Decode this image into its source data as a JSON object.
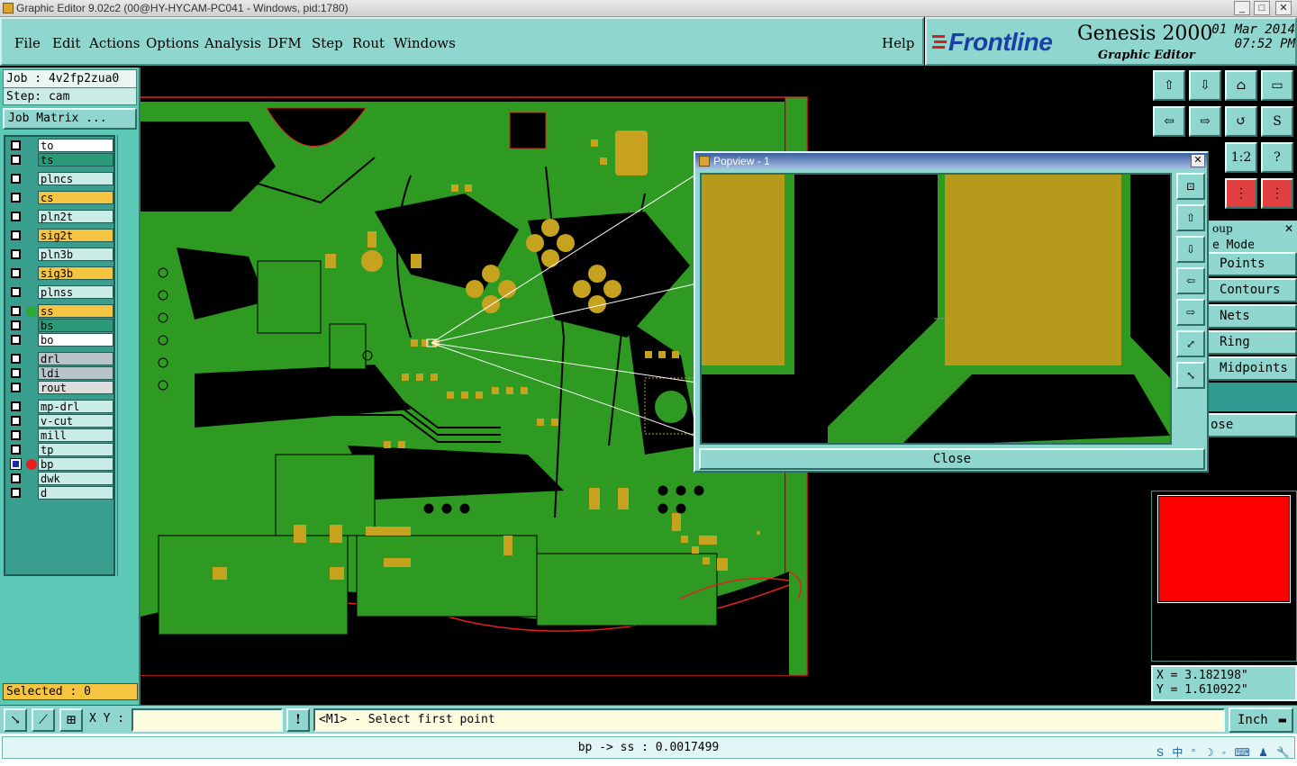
{
  "window": {
    "title": "Graphic Editor 9.02c2 (00@HY-HYCAM-PC041 - Windows, pid:1780)"
  },
  "menu": [
    "File",
    "Edit",
    "Actions",
    "Options",
    "Analysis",
    "DFM",
    "Step",
    "Rout",
    "Windows"
  ],
  "help_label": "Help",
  "logo": {
    "brand": "Frontline",
    "product": "Genesis 2000",
    "subtitle": "Graphic Editor",
    "date": "01 Mar 2014",
    "time": "07:52 PM"
  },
  "job": {
    "job_label": "Job : 4v2fp2zua0",
    "step_label": "Step: cam",
    "matrix_button": "Job Matrix ..."
  },
  "layers": [
    {
      "name": "to",
      "color": "#ffffff",
      "checked": false
    },
    {
      "name": "ts",
      "color": "#2a9a78",
      "checked": false
    },
    {
      "name": "plncs",
      "color": "#c9ece6",
      "checked": false
    },
    {
      "name": "cs",
      "color": "#f5c542",
      "checked": false
    },
    {
      "name": "pln2t",
      "color": "#c9ece6",
      "checked": false
    },
    {
      "name": "sig2t",
      "color": "#f5c542",
      "checked": false
    },
    {
      "name": "pln3b",
      "color": "#c9ece6",
      "checked": false
    },
    {
      "name": "sig3b",
      "color": "#f5c542",
      "checked": false
    },
    {
      "name": "plnss",
      "color": "#c9ece6",
      "checked": false
    },
    {
      "name": "ss",
      "color": "#f5c542",
      "checked": false,
      "dot": "#2fa82f"
    },
    {
      "name": "bs",
      "color": "#2a9a78",
      "checked": false
    },
    {
      "name": "bo",
      "color": "#ffffff",
      "checked": false
    },
    {
      "name": "drl",
      "color": "#b7c4c8",
      "checked": false
    },
    {
      "name": "ldi",
      "color": "#b7c4c8",
      "checked": false
    },
    {
      "name": "rout",
      "color": "#dcdcdc",
      "checked": false
    },
    {
      "name": "mp-drl",
      "color": "#c9ece6",
      "checked": false
    },
    {
      "name": "v-cut",
      "color": "#c9ece6",
      "checked": false
    },
    {
      "name": "mill",
      "color": "#c9ece6",
      "checked": false
    },
    {
      "name": "tp",
      "color": "#c9ece6",
      "checked": false
    },
    {
      "name": "bp",
      "color": "#c9ece6",
      "checked": true,
      "dot": "#e81d1d"
    },
    {
      "name": "dwk",
      "color": "#c9ece6",
      "checked": false
    },
    {
      "name": "d",
      "color": "#c9ece6",
      "checked": false
    }
  ],
  "selected": "Selected : 0",
  "popview": {
    "title": "Popview - 1",
    "close_label": "Close",
    "close_x": "✕"
  },
  "snap": {
    "header_fragment": "oup",
    "mode_fragment": "e Mode",
    "items": [
      "Points",
      "Contours",
      "Nets",
      "Ring",
      "Midpoints"
    ],
    "close_fragment": "ose"
  },
  "toolbar": {
    "ratio_label": "1:2",
    "question_label": "?"
  },
  "coords": {
    "x": "X = 3.182198\"",
    "y": "Y = 1.610922\""
  },
  "cmd": {
    "xy_label": "X Y :",
    "xy_value": "",
    "prompt": "<M1> - Select first point",
    "unit": "Inch"
  },
  "status": "bp -> ss : 0.0017499",
  "ime": "S 中 ° ☽ ◦ ⌨ ♟ 🔧"
}
